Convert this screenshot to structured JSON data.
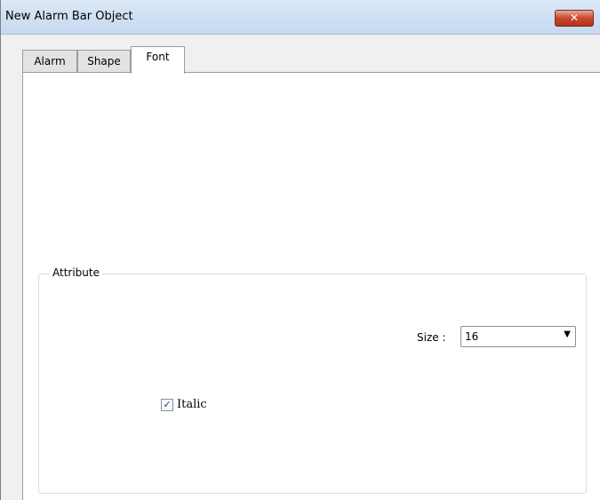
{
  "window": {
    "title": "New  Alarm Bar Object",
    "close_label": "✕"
  },
  "tabs": [
    {
      "label": "Alarm",
      "active": false
    },
    {
      "label": "Shape",
      "active": false
    },
    {
      "label": "Font",
      "active": true
    }
  ],
  "attribute_group": {
    "label": "Attribute",
    "size": {
      "label": "Size :",
      "value": "16"
    },
    "italic": {
      "label": "Italic",
      "checked": true
    }
  }
}
